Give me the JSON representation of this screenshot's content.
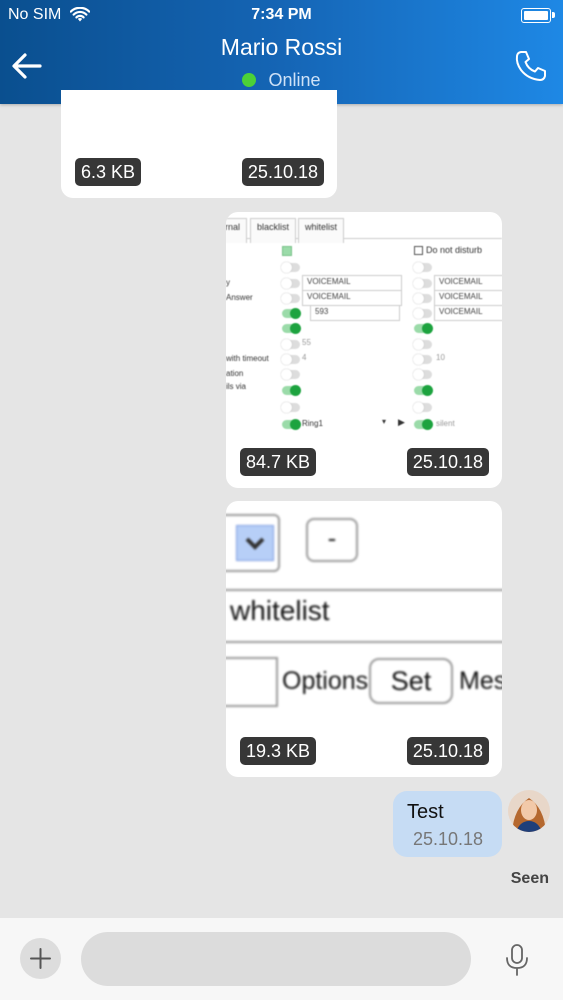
{
  "status_bar": {
    "carrier": "No SIM",
    "time": "7:34 PM"
  },
  "header": {
    "title": "Mario Rossi",
    "presence": "Online",
    "presence_color": "#4cd137"
  },
  "messages": [
    {
      "type": "file",
      "size": "6.3 KB",
      "date": "25.10.18"
    },
    {
      "type": "image",
      "size": "84.7 KB",
      "date": "25.10.18",
      "preview": {
        "tabs": [
          "rnal",
          "blacklist",
          "whitelist"
        ],
        "dnd_label": "Do not disturb",
        "row_labels": [
          "y",
          "Answer",
          "with timeout",
          "ation",
          "ils via"
        ],
        "left_selects": [
          "VOICEMAIL",
          "VOICEMAIL",
          "593",
          "55",
          "4",
          "Ring1"
        ],
        "right_selects": [
          "VOICEMAIL",
          "VOICEMAIL",
          "VOICEMAIL",
          "10",
          "silent"
        ]
      }
    },
    {
      "type": "image",
      "size": "19.3 KB",
      "date": "25.10.18",
      "preview": {
        "dash": "-",
        "whitelist": "whitelist",
        "options": "Options",
        "set": "Set",
        "mes": "Mes"
      }
    },
    {
      "type": "text",
      "text": "Test",
      "date": "25.10.18",
      "status": "Seen"
    }
  ],
  "composer": {
    "placeholder": ""
  },
  "icons": [
    "wifi-icon",
    "battery-icon",
    "back-arrow-icon",
    "phone-icon",
    "plus-icon",
    "microphone-icon"
  ]
}
